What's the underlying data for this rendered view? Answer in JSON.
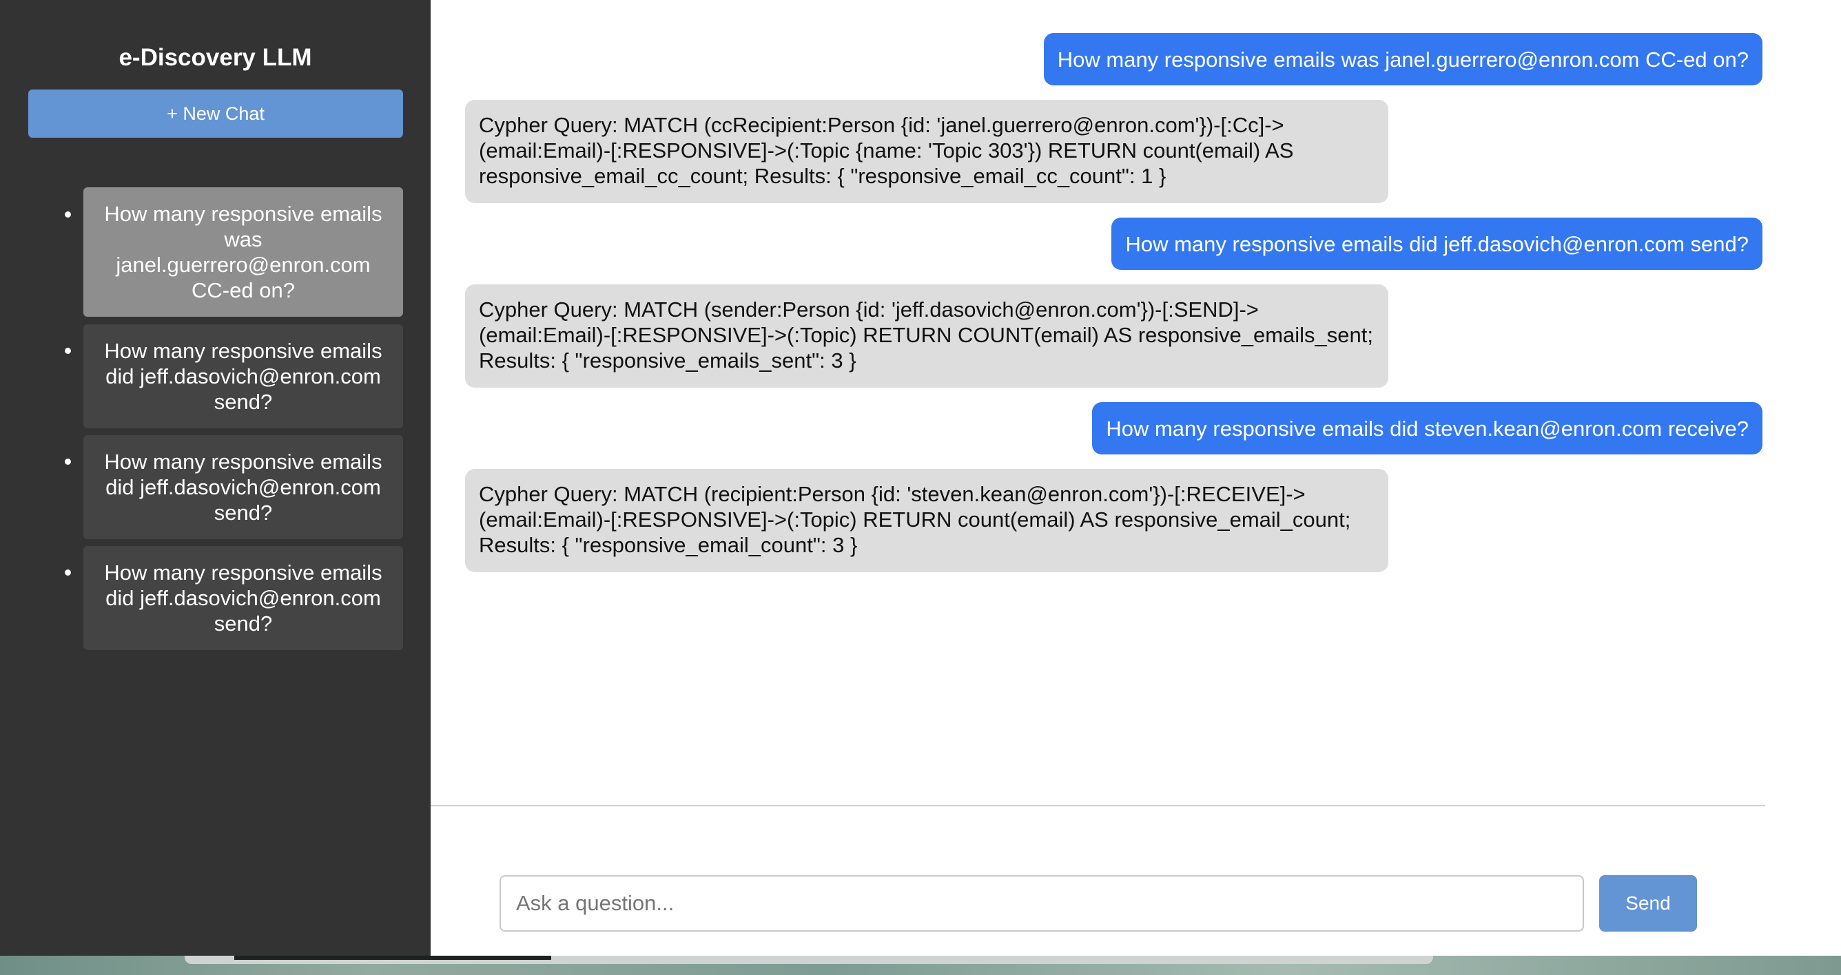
{
  "sidebar": {
    "title": "e-Discovery LLM",
    "new_chat_label": "+ New Chat",
    "history": [
      {
        "label": "How many responsive emails was janel.guerrero@enron.com CC-ed on?",
        "active": true
      },
      {
        "label": "How many responsive emails did jeff.dasovich@enron.com send?",
        "active": false
      },
      {
        "label": "How many responsive emails did jeff.dasovich@enron.com send?",
        "active": false
      },
      {
        "label": "How many responsive emails did jeff.dasovich@enron.com send?",
        "active": false
      }
    ]
  },
  "chat": {
    "messages": [
      {
        "role": "user",
        "text": "How many responsive emails was janel.guerrero@enron.com CC-ed on?"
      },
      {
        "role": "assistant",
        "text": "Cypher Query: MATCH (ccRecipient:Person {id: 'janel.guerrero@enron.com'})-[:Cc]->(email:Email)-[:RESPONSIVE]->(:Topic {name: 'Topic 303'}) RETURN count(email) AS responsive_email_cc_count; Results: { \"responsive_email_cc_count\": 1 }"
      },
      {
        "role": "user",
        "text": "How many responsive emails did jeff.dasovich@enron.com send?"
      },
      {
        "role": "assistant",
        "text": "Cypher Query: MATCH (sender:Person {id: 'jeff.dasovich@enron.com'})-[:SEND]->(email:Email)-[:RESPONSIVE]->(:Topic) RETURN COUNT(email) AS responsive_emails_sent; Results: { \"responsive_emails_sent\": 3 }"
      },
      {
        "role": "user",
        "text": "How many responsive emails did steven.kean@enron.com receive?"
      },
      {
        "role": "assistant",
        "text": "Cypher Query: MATCH (recipient:Person {id: 'steven.kean@enron.com'})-[:RECEIVE]->(email:Email)-[:RESPONSIVE]->(:Topic) RETURN count(email) AS responsive_email_count; Results: { \"responsive_email_count\": 3 }"
      }
    ]
  },
  "composer": {
    "placeholder": "Ask a question...",
    "value": "",
    "send_label": "Send"
  },
  "colors": {
    "sidebar_bg": "#333333",
    "history_item_bg": "#444444",
    "history_item_active_bg": "#8e8e8e",
    "accent_button": "#6394d4",
    "user_bubble": "#3478f1",
    "assistant_bubble": "#dddddd"
  }
}
